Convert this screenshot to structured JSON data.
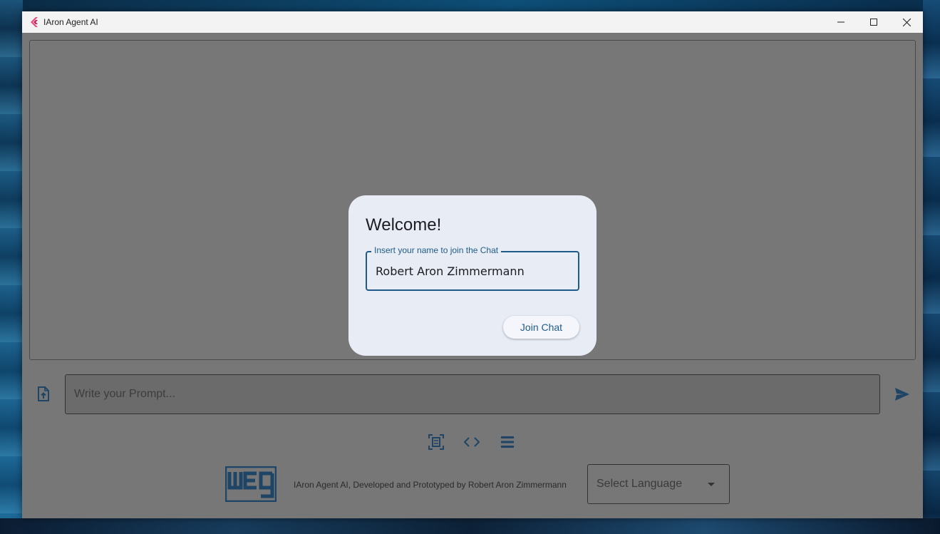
{
  "window": {
    "title": "IAron Agent AI",
    "accent": "#1e5b8a"
  },
  "chat": {
    "prompt_placeholder": "Write your Prompt...",
    "prompt_value": ""
  },
  "dialog": {
    "title": "Welcome!",
    "name_label": "Insert your name to join the Chat",
    "name_value": "Robert Aron Zimmermann",
    "join_button": "Join Chat"
  },
  "toolbar": {
    "icons": [
      "document-scanner-icon",
      "code-icon",
      "menu-icon"
    ]
  },
  "footer": {
    "logo": "weg-logo",
    "credit": "IAron Agent AI, Developed and Prototyped by Robert Aron Zimmermann",
    "language_select": "Select Language"
  }
}
